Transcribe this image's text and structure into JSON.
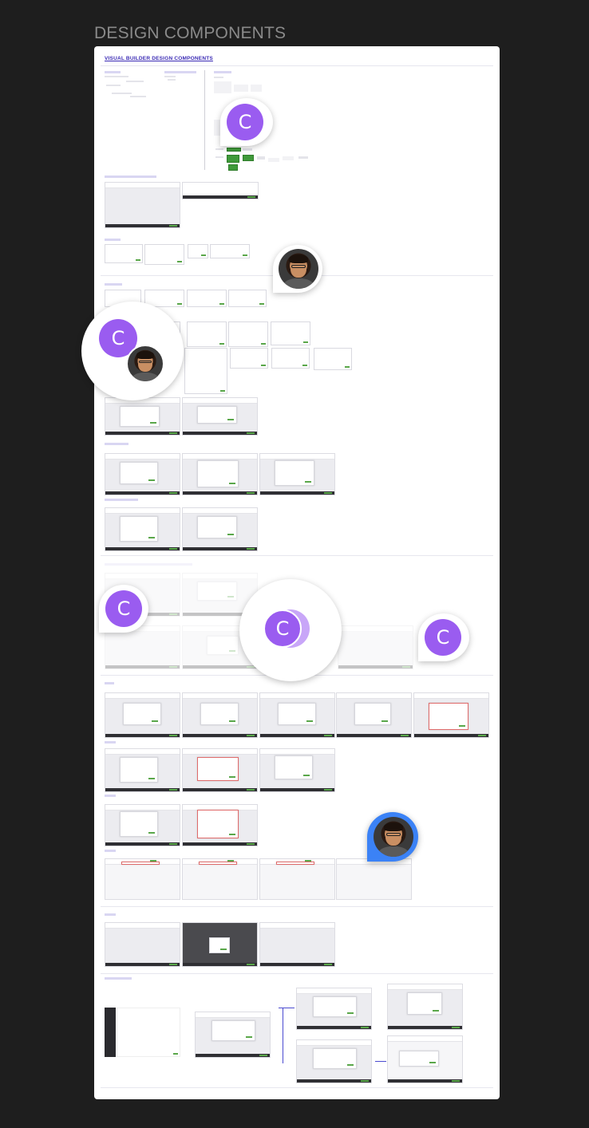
{
  "page_heading": "DESIGN COMPONENTS",
  "board": {
    "title": "VISUAL BUILDER DESIGN COMPONENTS"
  },
  "collaborators": {
    "c_initial": "C"
  },
  "colors": {
    "background": "#1e1e1e",
    "board": "#ffffff",
    "heading": "#8a8a8a",
    "accent_purple": "#3b2bb5",
    "avatar_purple": "#9a5cf0",
    "success_green": "#3f9a3a",
    "error_red": "#e06b6b",
    "selection_blue": "#3b82f6"
  },
  "icons": [
    "avatar-c-icon",
    "user-photo-avatar"
  ]
}
